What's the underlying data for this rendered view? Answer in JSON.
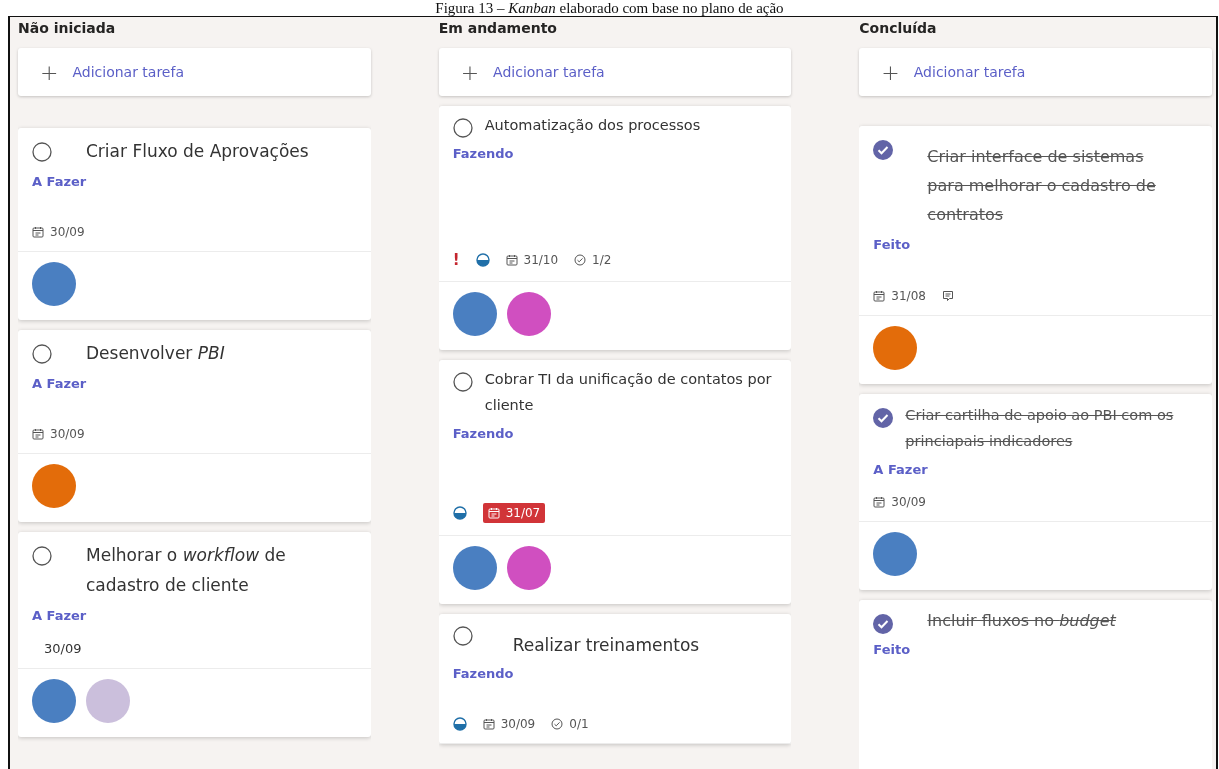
{
  "caption": "Figura 13 – *Kanban* elaborado com base no plano de ação",
  "columns": [
    {
      "title": "Não iniciada",
      "add_label": "Adicionar tarefa",
      "add_icon": "+",
      "tasks": [
        {
          "title": "Criar Fluxo de Aprovações",
          "completed": false,
          "label": "A Fazer",
          "meta": [
            {
              "kind": "date",
              "text": "30/09",
              "overdue": false
            }
          ],
          "avatars": [
            {
              "color": "#4a7fc1"
            }
          ]
        },
        {
          "title": "Desenvolver *PBI*",
          "completed": false,
          "label": "A Fazer",
          "meta": [
            {
              "kind": "date",
              "text": "30/09",
              "overdue": false
            }
          ],
          "avatars": [
            {
              "color": "#e36c0a"
            }
          ]
        },
        {
          "title": "Melhorar o *workflow* de cadastro de cliente",
          "completed": false,
          "label": "A Fazer",
          "meta": [
            {
              "kind": "text",
              "text": "30/09"
            }
          ],
          "avatars": [
            {
              "color": "#4a7fc1"
            },
            {
              "color": "#cbbfdc"
            }
          ]
        }
      ]
    },
    {
      "title": "Em andamento",
      "add_label": "Adicionar tarefa",
      "add_icon": "+",
      "tasks": [
        {
          "title": "Automatização dos processos",
          "completed": false,
          "label": "Fazendo",
          "meta": [
            {
              "kind": "priority",
              "text": "!"
            },
            {
              "kind": "progress"
            },
            {
              "kind": "date",
              "text": "31/10",
              "overdue": false
            },
            {
              "kind": "checklist",
              "text": "1/2"
            }
          ],
          "avatars": [
            {
              "color": "#4a7fc1"
            },
            {
              "color": "#d04fc0"
            }
          ]
        },
        {
          "title": "Cobrar TI da unificação de contatos por cliente",
          "completed": false,
          "label": "Fazendo",
          "meta": [
            {
              "kind": "progress"
            },
            {
              "kind": "date",
              "text": "31/07",
              "overdue": true
            }
          ],
          "avatars": [
            {
              "color": "#4a7fc1"
            },
            {
              "color": "#d04fc0"
            }
          ]
        },
        {
          "title": "Realizar treinamentos",
          "completed": false,
          "label": "Fazendo",
          "meta": [
            {
              "kind": "progress"
            },
            {
              "kind": "date",
              "text": "30/09",
              "overdue": false
            },
            {
              "kind": "checklist",
              "text": "0/1"
            }
          ]
        }
      ]
    },
    {
      "title": "Concluída",
      "add_label": "Adicionar tarefa",
      "add_icon": "+",
      "tasks": [
        {
          "title": "Criar interface de sistemas para melhorar o cadastro de contratos",
          "completed": true,
          "label": "Feito",
          "meta": [
            {
              "kind": "date",
              "text": "31/08",
              "overdue": false
            },
            {
              "kind": "comment"
            }
          ],
          "avatars": [
            {
              "color": "#e36c0a"
            }
          ]
        },
        {
          "title": "Criar cartilha de apoio ao PBI com os princiapais indicadores",
          "completed": true,
          "label": "A Fazer",
          "meta": [
            {
              "kind": "date",
              "text": "30/09",
              "overdue": false
            }
          ],
          "avatars": [
            {
              "color": "#4a7fc1"
            }
          ]
        },
        {
          "title": "Incluir fluxos no *budget*",
          "completed": true,
          "label": "Feito"
        }
      ]
    }
  ]
}
